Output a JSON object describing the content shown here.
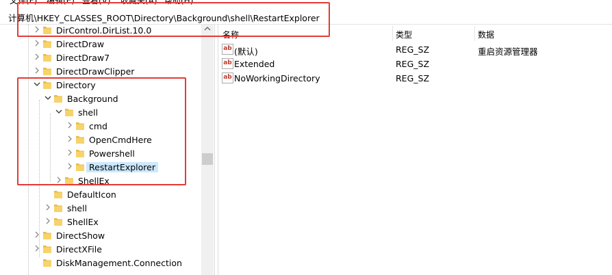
{
  "menubar": {
    "items": [
      "文件(F)",
      "编辑(E)",
      "查看(V)",
      "收藏夹(A)",
      "帮助(H)"
    ]
  },
  "address": {
    "path": "计算机\\HKEY_CLASSES_ROOT\\Directory\\Background\\shell\\RestartExplorer"
  },
  "tree": {
    "items": [
      {
        "label": "DirControl.DirList.10.0",
        "expanded": false,
        "selected": false
      },
      {
        "label": "DirectDraw",
        "expanded": false,
        "selected": false
      },
      {
        "label": "DirectDraw7",
        "expanded": false,
        "selected": false
      },
      {
        "label": "DirectDrawClipper",
        "expanded": false,
        "selected": false
      },
      {
        "label": "Directory",
        "expanded": true,
        "selected": false
      },
      {
        "label": "Background",
        "expanded": true,
        "selected": false
      },
      {
        "label": "shell",
        "expanded": true,
        "selected": false
      },
      {
        "label": "cmd",
        "expanded": false,
        "selected": false
      },
      {
        "label": "OpenCmdHere",
        "expanded": false,
        "selected": false
      },
      {
        "label": "Powershell",
        "expanded": false,
        "selected": false
      },
      {
        "label": "RestartExplorer",
        "expanded": false,
        "selected": true
      },
      {
        "label": "ShellEx",
        "expanded": false,
        "selected": false
      },
      {
        "label": "DefaultIcon",
        "expanded": false,
        "selected": false
      },
      {
        "label": "shell",
        "expanded": false,
        "selected": false
      },
      {
        "label": "ShellEx",
        "expanded": false,
        "selected": false
      },
      {
        "label": "DirectShow",
        "expanded": false,
        "selected": false
      },
      {
        "label": "DirectXFile",
        "expanded": false,
        "selected": false
      },
      {
        "label": "DiskManagement.Connection",
        "expanded": false,
        "selected": false
      }
    ]
  },
  "values": {
    "columns": {
      "name": "名称",
      "type": "类型",
      "data": "数据"
    },
    "rows": [
      {
        "name": "(默认)",
        "type": "REG_SZ",
        "data": "重启资源管理器"
      },
      {
        "name": "Extended",
        "type": "REG_SZ",
        "data": ""
      },
      {
        "name": "NoWorkingDirectory",
        "type": "REG_SZ",
        "data": ""
      }
    ]
  },
  "icons": {
    "folder": "folder-icon",
    "value": "string-value-icon",
    "expand": "chevron-right-icon",
    "collapse": "chevron-down-icon"
  },
  "colors": {
    "highlight": "#e53935",
    "selection": "#cce8ff",
    "folder": "#f7d36b"
  }
}
